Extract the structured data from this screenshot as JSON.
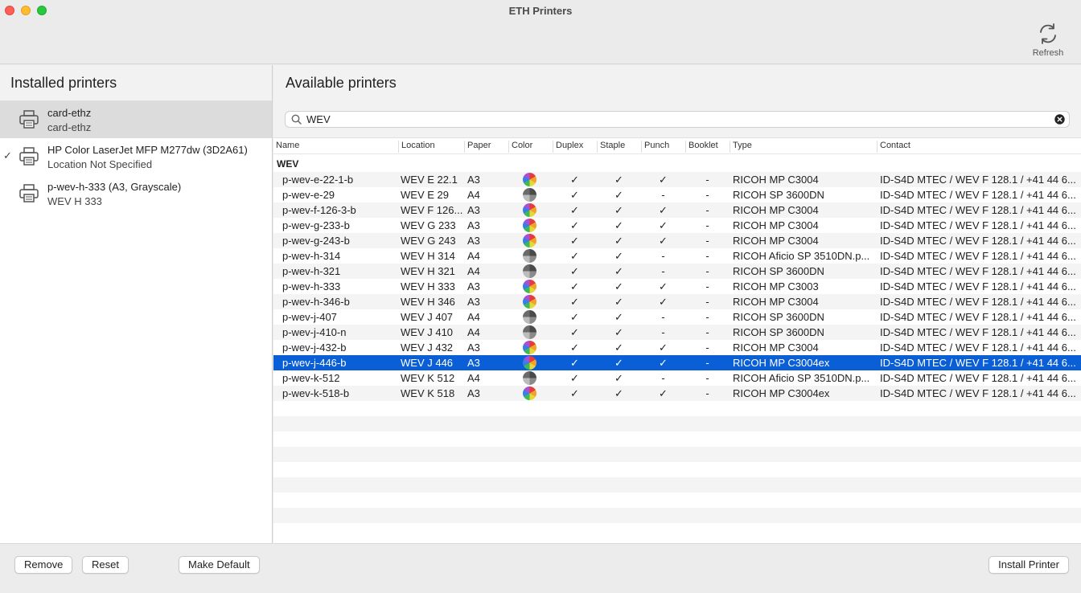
{
  "window": {
    "title": "ETH Printers",
    "refresh_label": "Refresh"
  },
  "installed": {
    "header": "Installed printers",
    "items": [
      {
        "name": "card-ethz",
        "sub": "card-ethz",
        "default": false,
        "selected": true
      },
      {
        "name": "HP Color LaserJet MFP M277dw (3D2A61)",
        "sub": "Location Not Specified",
        "default": true,
        "selected": false
      },
      {
        "name": "p-wev-h-333 (A3, Grayscale)",
        "sub": "WEV H 333",
        "default": false,
        "selected": false
      }
    ],
    "check_mark": "✓",
    "buttons": {
      "remove": "Remove",
      "reset": "Reset",
      "make_default": "Make Default"
    }
  },
  "available": {
    "header": "Available printers",
    "search": {
      "value": "WEV",
      "placeholder": "Search"
    },
    "columns": [
      "Name",
      "Location",
      "Paper",
      "Color",
      "Duplex",
      "Staple",
      "Punch",
      "Booklet",
      "Type",
      "Contact"
    ],
    "group": "WEV",
    "rows": [
      {
        "name": "p-wev-e-22-1-b",
        "location": "WEV E 22.1",
        "paper": "A3",
        "color": "color",
        "duplex": "✓",
        "staple": "✓",
        "punch": "✓",
        "booklet": "-",
        "type": "RICOH MP C3004",
        "contact": "ID-S4D MTEC / WEV F 128.1 / +41 44 6..."
      },
      {
        "name": "p-wev-e-29",
        "location": "WEV E 29",
        "paper": "A4",
        "color": "gray",
        "duplex": "✓",
        "staple": "✓",
        "punch": "-",
        "booklet": "-",
        "type": "RICOH SP 3600DN",
        "contact": "ID-S4D MTEC / WEV F 128.1 / +41 44 6..."
      },
      {
        "name": "p-wev-f-126-3-b",
        "location": "WEV F 126...",
        "paper": "A3",
        "color": "color",
        "duplex": "✓",
        "staple": "✓",
        "punch": "✓",
        "booklet": "-",
        "type": "RICOH MP C3004",
        "contact": "ID-S4D MTEC / WEV F 128.1 / +41 44 6..."
      },
      {
        "name": "p-wev-g-233-b",
        "location": "WEV G 233",
        "paper": "A3",
        "color": "color",
        "duplex": "✓",
        "staple": "✓",
        "punch": "✓",
        "booklet": "-",
        "type": "RICOH MP C3004",
        "contact": "ID-S4D MTEC / WEV F 128.1 / +41 44 6..."
      },
      {
        "name": "p-wev-g-243-b",
        "location": "WEV G 243",
        "paper": "A3",
        "color": "color",
        "duplex": "✓",
        "staple": "✓",
        "punch": "✓",
        "booklet": "-",
        "type": "RICOH MP C3004",
        "contact": "ID-S4D MTEC / WEV F 128.1 / +41 44 6..."
      },
      {
        "name": "p-wev-h-314",
        "location": "WEV H 314",
        "paper": "A4",
        "color": "gray",
        "duplex": "✓",
        "staple": "✓",
        "punch": "-",
        "booklet": "-",
        "type": "RICOH Aficio SP 3510DN.p...",
        "contact": "ID-S4D MTEC / WEV F 128.1 / +41 44 6..."
      },
      {
        "name": "p-wev-h-321",
        "location": "WEV H 321",
        "paper": "A4",
        "color": "gray",
        "duplex": "✓",
        "staple": "✓",
        "punch": "-",
        "booklet": "-",
        "type": "RICOH SP 3600DN",
        "contact": "ID-S4D MTEC / WEV F 128.1 / +41 44 6..."
      },
      {
        "name": "p-wev-h-333",
        "location": "WEV H 333",
        "paper": "A3",
        "color": "color",
        "duplex": "✓",
        "staple": "✓",
        "punch": "✓",
        "booklet": "-",
        "type": "RICOH MP C3003",
        "contact": "ID-S4D MTEC / WEV F 128.1 / +41 44 6..."
      },
      {
        "name": "p-wev-h-346-b",
        "location": "WEV H 346",
        "paper": "A3",
        "color": "color",
        "duplex": "✓",
        "staple": "✓",
        "punch": "✓",
        "booklet": "-",
        "type": "RICOH MP C3004",
        "contact": "ID-S4D MTEC / WEV F 128.1 / +41 44 6..."
      },
      {
        "name": "p-wev-j-407",
        "location": "WEV J 407",
        "paper": "A4",
        "color": "gray",
        "duplex": "✓",
        "staple": "✓",
        "punch": "-",
        "booklet": "-",
        "type": "RICOH SP 3600DN",
        "contact": "ID-S4D MTEC / WEV F 128.1 / +41 44 6..."
      },
      {
        "name": "p-wev-j-410-n",
        "location": "WEV J 410",
        "paper": "A4",
        "color": "gray",
        "duplex": "✓",
        "staple": "✓",
        "punch": "-",
        "booklet": "-",
        "type": "RICOH SP 3600DN",
        "contact": "ID-S4D MTEC / WEV F 128.1 / +41 44 6..."
      },
      {
        "name": "p-wev-j-432-b",
        "location": "WEV J 432",
        "paper": "A3",
        "color": "color",
        "duplex": "✓",
        "staple": "✓",
        "punch": "✓",
        "booklet": "-",
        "type": "RICOH MP C3004",
        "contact": "ID-S4D MTEC / WEV F 128.1 / +41 44 6..."
      },
      {
        "name": "p-wev-j-446-b",
        "location": "WEV J 446",
        "paper": "A3",
        "color": "color",
        "duplex": "✓",
        "staple": "✓",
        "punch": "✓",
        "booklet": "-",
        "type": "RICOH MP C3004ex",
        "contact": "ID-S4D MTEC / WEV F 128.1 / +41 44 6...",
        "selected": true
      },
      {
        "name": "p-wev-k-512",
        "location": "WEV K 512",
        "paper": "A4",
        "color": "gray",
        "duplex": "✓",
        "staple": "✓",
        "punch": "-",
        "booklet": "-",
        "type": "RICOH Aficio SP 3510DN.p...",
        "contact": "ID-S4D MTEC / WEV F 128.1 / +41 44 6..."
      },
      {
        "name": "p-wev-k-518-b",
        "location": "WEV K 518",
        "paper": "A3",
        "color": "color",
        "duplex": "✓",
        "staple": "✓",
        "punch": "✓",
        "booklet": "-",
        "type": "RICOH MP C3004ex",
        "contact": "ID-S4D MTEC / WEV F 128.1 / +41 44 6..."
      }
    ],
    "install_button": "Install Printer"
  },
  "colors": {
    "selection": "#0a5fd6",
    "close": "#ff5f57",
    "minimize": "#febc2e",
    "maximize": "#28c840"
  },
  "icons": {
    "refresh": "refresh-icon",
    "printer": "printer-icon",
    "search": "search-icon",
    "clear": "clear-icon",
    "color": "color-wheel-icon",
    "gray": "grayscale-wheel-icon"
  }
}
